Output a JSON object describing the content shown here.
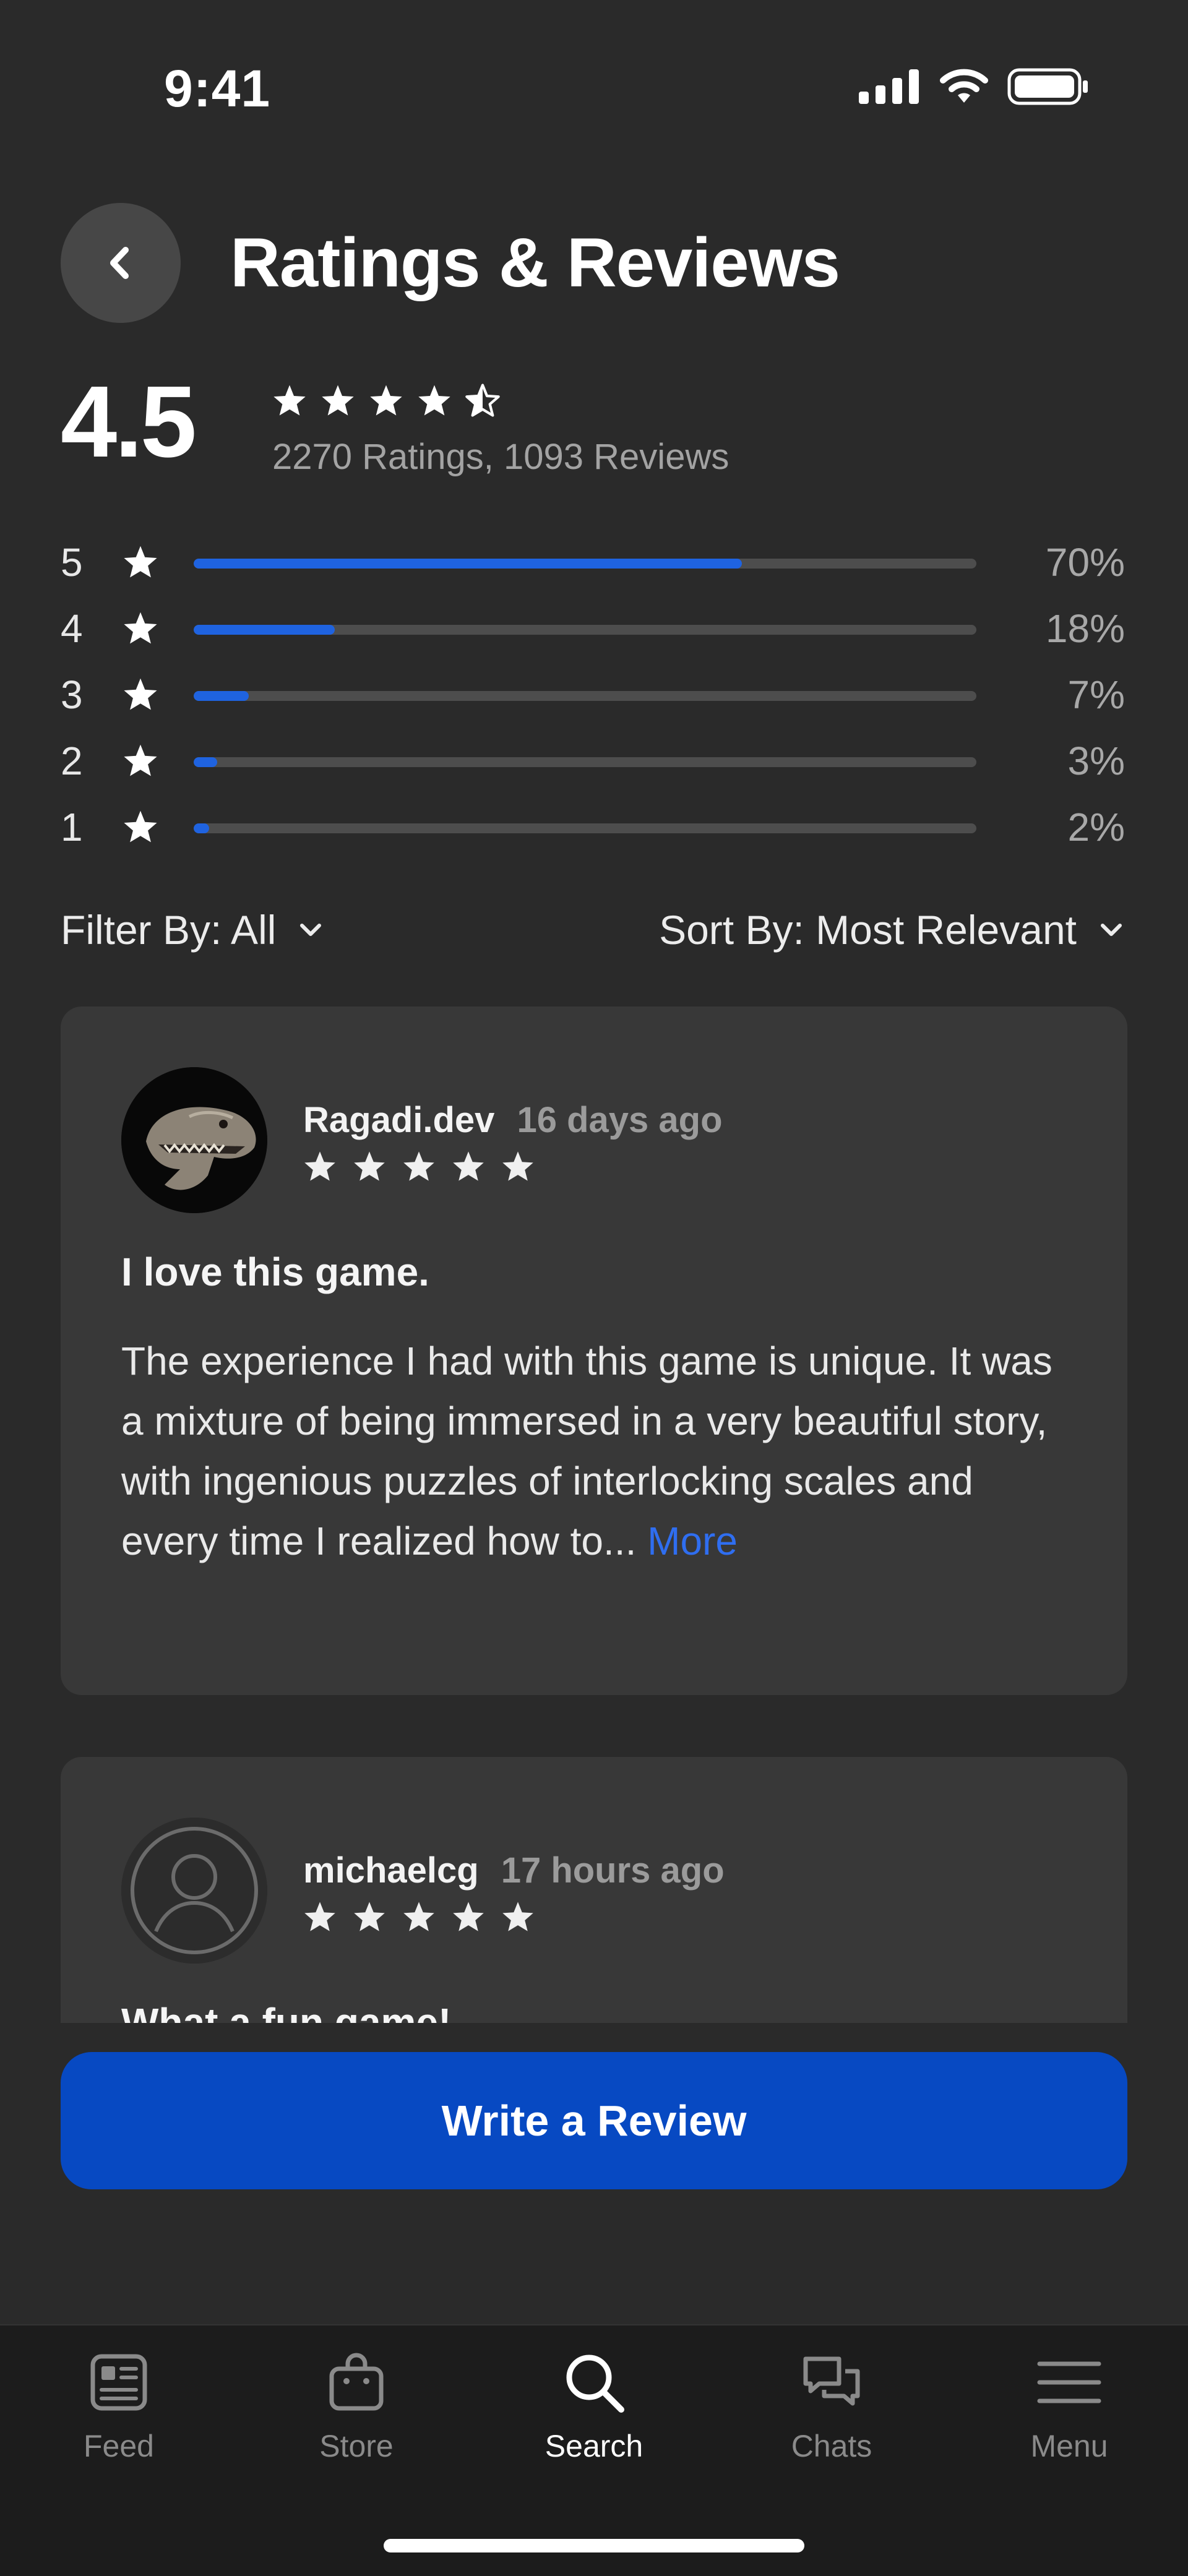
{
  "status": {
    "time": "9:41"
  },
  "header": {
    "title": "Ratings & Reviews"
  },
  "summary": {
    "average": "4.5",
    "stars_value": 4.5,
    "counts": "2270 Ratings, 1093 Reviews"
  },
  "distribution": [
    {
      "stars": "5",
      "percent": "70%",
      "fill": 0.7
    },
    {
      "stars": "4",
      "percent": "18%",
      "fill": 0.18
    },
    {
      "stars": "3",
      "percent": "7%",
      "fill": 0.07
    },
    {
      "stars": "2",
      "percent": "3%",
      "fill": 0.03
    },
    {
      "stars": "1",
      "percent": "2%",
      "fill": 0.02
    }
  ],
  "filters": {
    "filter_label": "Filter By: All",
    "sort_label": "Sort By: Most Relevant"
  },
  "reviews": [
    {
      "author": "Ragadi.dev",
      "time": "16 days ago",
      "rating": 5,
      "title": "I love this game.",
      "body": "The experience I had with this game is unique. It was a mixture of being immersed in a very beautiful story, with ingenious puzzles of interlocking scales and every time I realized how to...",
      "more_label": "More",
      "avatar_icon": "dinosaur-avatar"
    },
    {
      "author": "michaelcg",
      "time": "17 hours ago",
      "rating": 5,
      "title": "What a fun game!",
      "avatar_icon": "default-user-avatar"
    }
  ],
  "actions": {
    "write_review": "Write a Review"
  },
  "bottom_nav": [
    {
      "label": "Feed",
      "icon": "feed-icon",
      "active": false
    },
    {
      "label": "Store",
      "icon": "store-icon",
      "active": false
    },
    {
      "label": "Search",
      "icon": "search-icon",
      "active": true
    },
    {
      "label": "Chats",
      "icon": "chats-icon",
      "active": false
    },
    {
      "label": "Menu",
      "icon": "menu-icon",
      "active": false
    }
  ],
  "colors": {
    "background": "#2a2a2a",
    "card": "#383838",
    "accent": "#1f63e0",
    "button": "#0749c2"
  }
}
